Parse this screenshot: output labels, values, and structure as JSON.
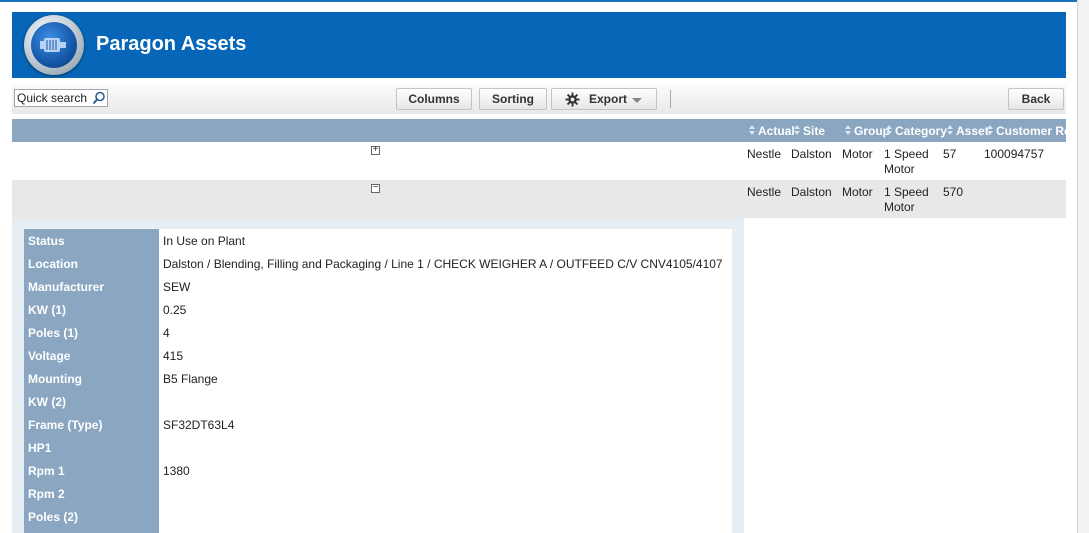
{
  "app": {
    "title": "Paragon Assets"
  },
  "toolbar": {
    "search_placeholder": "Quick search",
    "columns_label": "Columns",
    "sorting_label": "Sorting",
    "export_label": "Export",
    "back_label": "Back"
  },
  "grid": {
    "columns": [
      "Actual",
      "Site",
      "Group",
      "Category",
      "Asset",
      "Customer Re"
    ],
    "rows": [
      {
        "toggle": "+",
        "cells": [
          "Nestle",
          "Dalston",
          "Motor",
          "1 Speed Motor",
          "57",
          "100094757"
        ]
      },
      {
        "toggle": "−",
        "cells": [
          "Nestle",
          "Dalston",
          "Motor",
          "1 Speed Motor",
          "570",
          ""
        ]
      }
    ]
  },
  "detail": {
    "fields": [
      {
        "label": "Status",
        "value": "In Use on Plant"
      },
      {
        "label": "Location",
        "value": "Dalston / Blending, Filling and Packaging / Line 1 / CHECK WEIGHER A / OUTFEED C/V CNV4105/4107"
      },
      {
        "label": "Manufacturer",
        "value": "SEW"
      },
      {
        "label": "KW (1)",
        "value": "0.25"
      },
      {
        "label": "Poles (1)",
        "value": "4"
      },
      {
        "label": "Voltage",
        "value": "415"
      },
      {
        "label": "Mounting",
        "value": "B5 Flange"
      },
      {
        "label": "KW (2)",
        "value": ""
      },
      {
        "label": "Frame (Type)",
        "value": "SF32DT63L4"
      },
      {
        "label": "HP1",
        "value": ""
      },
      {
        "label": "Rpm 1",
        "value": "1380"
      },
      {
        "label": "Rpm 2",
        "value": ""
      },
      {
        "label": "Poles (2)",
        "value": ""
      }
    ]
  },
  "colors": {
    "header_blue": "#0766b7",
    "grid_header": "#8aa6c1",
    "alt_row": "#e8e8e8"
  }
}
